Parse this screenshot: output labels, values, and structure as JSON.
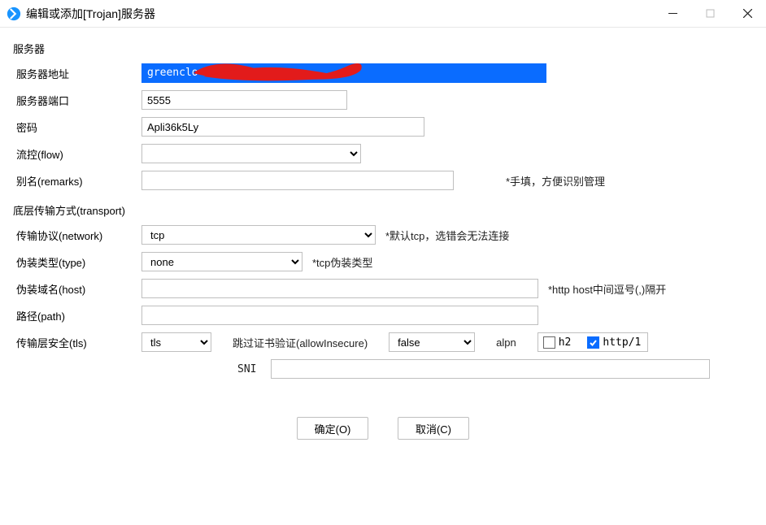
{
  "window": {
    "title": "编辑或添加[Trojan]服务器"
  },
  "groups": {
    "server": "服务器",
    "transport": "底层传输方式(transport)"
  },
  "fields": {
    "address": {
      "label": "服务器地址",
      "value_visible": "greenclo"
    },
    "port": {
      "label": "服务器端口",
      "value": "5555"
    },
    "password": {
      "label": "密码",
      "value": "Apli36k5Ly"
    },
    "flow": {
      "label": "流控(flow)",
      "value": ""
    },
    "remarks": {
      "label": "别名(remarks)",
      "value": "",
      "hint": "*手填，方便识别管理"
    },
    "network": {
      "label": "传输协议(network)",
      "value": "tcp",
      "hint": "*默认tcp，选错会无法连接"
    },
    "type": {
      "label": "伪装类型(type)",
      "value": "none",
      "hint": "*tcp伪装类型"
    },
    "host": {
      "label": "伪装域名(host)",
      "value": "",
      "hint": "*http host中间逗号(,)隔开"
    },
    "path": {
      "label": "路径(path)",
      "value": ""
    },
    "tls": {
      "label": "传输层安全(tls)",
      "value": "tls"
    },
    "allowInsecure": {
      "label": "跳过证书验证(allowInsecure)",
      "value": "false"
    },
    "alpn": {
      "label": "alpn",
      "h2": {
        "label": "h2",
        "checked": false
      },
      "http1": {
        "label": "http/1",
        "checked": true
      }
    },
    "sni": {
      "label": "SNI",
      "value": ""
    }
  },
  "buttons": {
    "ok": "确定(O)",
    "cancel": "取消(C)"
  }
}
